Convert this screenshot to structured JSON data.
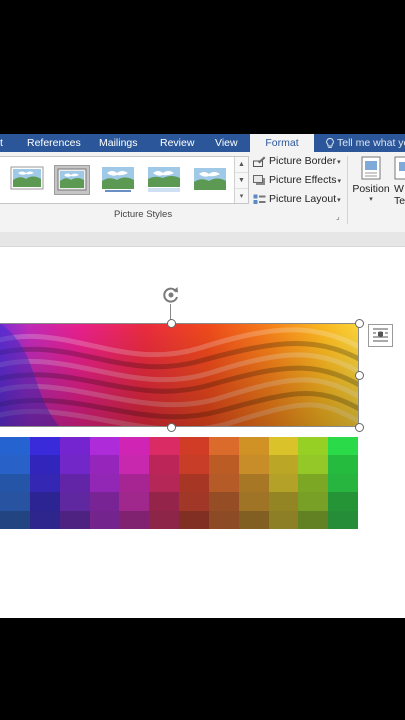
{
  "ribbon": {
    "tabs": [
      {
        "label": "t"
      },
      {
        "label": "References"
      },
      {
        "label": "Mailings"
      },
      {
        "label": "Review"
      },
      {
        "label": "View"
      },
      {
        "label": "Format",
        "active": true
      }
    ],
    "tell_me": "Tell me what yo",
    "picture_styles_label": "Picture Styles",
    "commands": {
      "border": "Picture Border",
      "effects": "Picture Effects",
      "layout": "Picture Layout"
    },
    "position_label": "Position",
    "wrap_label_1": "W",
    "wrap_label_2": "Te"
  },
  "colors": {
    "ribbon_blue": "#2b579a",
    "ribbon_bg": "#f3f3f3",
    "page_bg": "#ffffff"
  },
  "icons": [
    "lightbulb-icon",
    "picture-border-icon",
    "picture-effects-icon",
    "picture-layout-icon",
    "position-icon",
    "wrap-text-icon",
    "rotate-handle-icon",
    "layout-options-icon",
    "gallery-up-icon",
    "gallery-down-icon",
    "gallery-more-icon",
    "dialog-launcher-icon"
  ]
}
